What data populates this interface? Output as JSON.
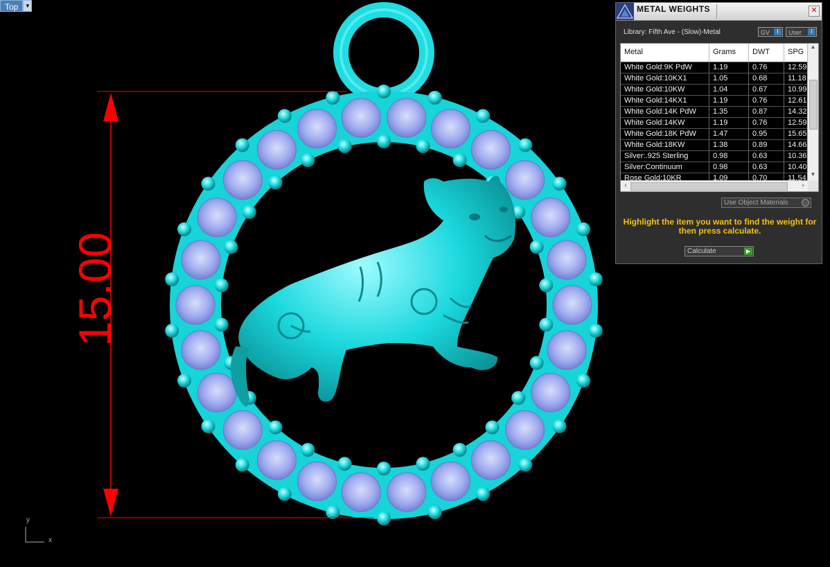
{
  "viewport": {
    "name": "Top",
    "dimension_value": "15.00",
    "axis_x_label": "x",
    "axis_y_label": "y",
    "colors": {
      "model": "#19e6ea",
      "gem": "#a8b4f5",
      "dimension": "#ff0000",
      "background": "#000000"
    }
  },
  "panel": {
    "title": "METAL WEIGHTS",
    "library_label": "Library: Fifth Ave - (Slow)-Metal",
    "gv_button": "GV",
    "user_button": "User",
    "table": {
      "headers": [
        "Metal",
        "Grams",
        "DWT",
        "SPG"
      ],
      "rows": [
        [
          "White Gold:9K PdW",
          "1.19",
          "0.76",
          "12.59"
        ],
        [
          "White Gold:10KX1",
          "1.05",
          "0.68",
          "11.18"
        ],
        [
          "White Gold:10KW",
          "1.04",
          "0.67",
          "10.99"
        ],
        [
          "White Gold:14KX1",
          "1.19",
          "0.76",
          "12.61"
        ],
        [
          "White Gold:14K PdW",
          "1.35",
          "0.87",
          "14.32"
        ],
        [
          "White Gold:14KW",
          "1.19",
          "0.76",
          "12.59"
        ],
        [
          "White Gold:18K PdW",
          "1.47",
          "0.95",
          "15.65"
        ],
        [
          "White Gold:18KW",
          "1.38",
          "0.89",
          "14.66"
        ],
        [
          "Silver:.925 Sterling",
          "0.98",
          "0.63",
          "10.36"
        ],
        [
          "Silver:Continuum",
          "0.98",
          "0.63",
          "10.40"
        ],
        [
          "Rose Gold:10KR",
          "1.09",
          "0.70",
          "11.54"
        ]
      ]
    },
    "use_object_materials": "Use Object Materials",
    "hint": "Highlight the item you want to find the weight for then press calculate.",
    "calculate_button": "Calculate"
  }
}
